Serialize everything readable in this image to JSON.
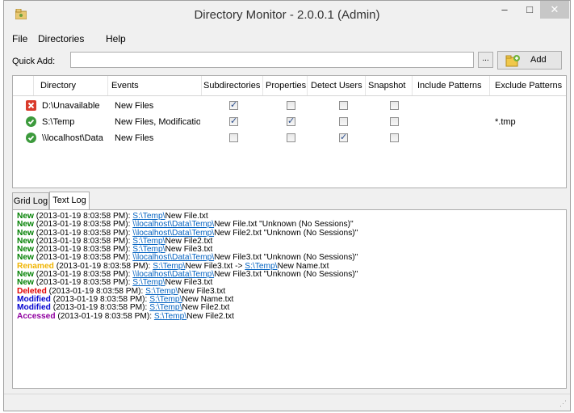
{
  "window": {
    "title": "Directory Monitor - 2.0.0.1 (Admin)",
    "minimize": "–",
    "maximize": "□",
    "close": "✕"
  },
  "menu": [
    "File",
    "Directories",
    "Help"
  ],
  "quick_add": {
    "label": "Quick Add:",
    "value": "",
    "browse": "...",
    "add_label": "Add"
  },
  "grid": {
    "columns": [
      "Directory",
      "Events",
      "Subdirectories",
      "Properties",
      "Detect Users",
      "Snapshot",
      "Include Patterns",
      "Exclude Patterns"
    ],
    "rows": [
      {
        "status": "error",
        "directory": "D:\\Unavailable",
        "events": "New Files",
        "subdirectories": true,
        "properties": false,
        "detect_users": false,
        "snapshot": false,
        "include": "",
        "exclude": ""
      },
      {
        "status": "ok",
        "directory": "S:\\Temp",
        "events": "New Files, Modificatio...",
        "subdirectories": true,
        "properties": true,
        "detect_users": false,
        "snapshot": false,
        "include": "",
        "exclude": "*.tmp"
      },
      {
        "status": "ok",
        "directory": "\\\\localhost\\Data",
        "events": "New Files",
        "subdirectories": false,
        "properties": false,
        "detect_users": true,
        "snapshot": false,
        "include": "",
        "exclude": ""
      }
    ]
  },
  "tabs": [
    "Grid Log",
    "Text Log"
  ],
  "active_tab": "Text Log",
  "log": [
    {
      "kind": "New",
      "color": "#008000",
      "ts": " (2013-01-19 8:03:58 PM): ",
      "link": "S:\\Temp\\",
      "rest": "New File.txt"
    },
    {
      "kind": "New",
      "color": "#008000",
      "ts": " (2013-01-19 8:03:58 PM): ",
      "link": "\\\\localhost\\Data\\Temp\\",
      "rest": "New File.txt \"Unknown (No Sessions)\""
    },
    {
      "kind": "New",
      "color": "#008000",
      "ts": " (2013-01-19 8:03:58 PM): ",
      "link": "\\\\localhost\\Data\\Temp\\",
      "rest": "New File2.txt \"Unknown (No Sessions)\""
    },
    {
      "kind": "New",
      "color": "#008000",
      "ts": " (2013-01-19 8:03:58 PM): ",
      "link": "S:\\Temp\\",
      "rest": "New File2.txt"
    },
    {
      "kind": "New",
      "color": "#008000",
      "ts": " (2013-01-19 8:03:58 PM): ",
      "link": "S:\\Temp\\",
      "rest": "New File3.txt"
    },
    {
      "kind": "New",
      "color": "#008000",
      "ts": " (2013-01-19 8:03:58 PM): ",
      "link": "\\\\localhost\\Data\\Temp\\",
      "rest": "New File3.txt \"Unknown (No Sessions)\""
    },
    {
      "kind": "Renamed",
      "color": "#f0b400",
      "ts": " (2013-01-19 8:03:58 PM): ",
      "link": "S:\\Temp\\",
      "rest": "New File3.txt -> ",
      "link2": "S:\\Temp\\",
      "rest2": "New Name.txt"
    },
    {
      "kind": "New",
      "color": "#008000",
      "ts": " (2013-01-19 8:03:58 PM): ",
      "link": "\\\\localhost\\Data\\Temp\\",
      "rest": "New File3.txt \"Unknown (No Sessions)\""
    },
    {
      "kind": "New",
      "color": "#008000",
      "ts": " (2013-01-19 8:03:58 PM): ",
      "link": "S:\\Temp\\",
      "rest": "New File3.txt"
    },
    {
      "kind": "Deleted",
      "color": "#e00000",
      "ts": " (2013-01-19 8:03:58 PM): ",
      "link": "S:\\Temp\\",
      "rest": "New File3.txt"
    },
    {
      "kind": "Modified",
      "color": "#0000d0",
      "ts": " (2013-01-19 8:03:58 PM): ",
      "link": "S:\\Temp\\",
      "rest": "New Name.txt"
    },
    {
      "kind": "Modified",
      "color": "#0000d0",
      "ts": " (2013-01-19 8:03:58 PM): ",
      "link": "S:\\Temp\\",
      "rest": "New File2.txt"
    },
    {
      "kind": "Accessed",
      "color": "#9000a0",
      "ts": " (2013-01-19 8:03:58 PM): ",
      "link": "S:\\Temp\\",
      "rest": "New File2.txt"
    }
  ],
  "statusbar": {
    "grip": "⋰"
  }
}
